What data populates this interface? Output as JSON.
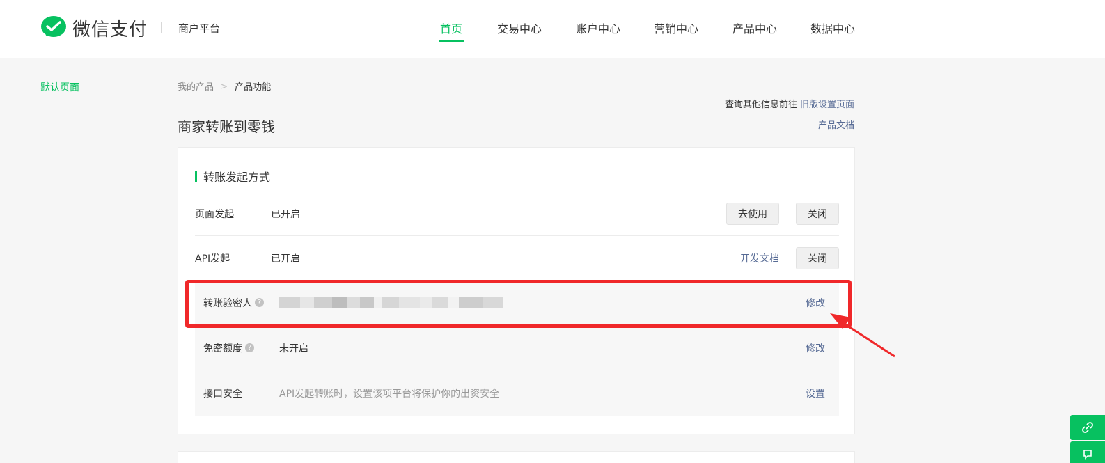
{
  "header": {
    "logo_text": "微信支付",
    "platform": "商户平台",
    "nav": [
      {
        "label": "首页",
        "active": true
      },
      {
        "label": "交易中心",
        "active": false
      },
      {
        "label": "账户中心",
        "active": false
      },
      {
        "label": "营销中心",
        "active": false
      },
      {
        "label": "产品中心",
        "active": false
      },
      {
        "label": "数据中心",
        "active": false
      }
    ]
  },
  "sidebar": {
    "items": [
      {
        "label": "默认页面",
        "active": true
      }
    ]
  },
  "breadcrumb": {
    "parent": "我的产品",
    "separator": ">",
    "current": "产品功能"
  },
  "page": {
    "title": "商家转账到零钱",
    "info_prefix": "查询其他信息前往",
    "old_settings_link": "旧版设置页面",
    "docs_link": "产品文档"
  },
  "section": {
    "title": "转账发起方式",
    "rows": [
      {
        "label": "页面发起",
        "status": "已开启",
        "primary_action": "去使用",
        "secondary_action": "关闭"
      },
      {
        "label": "API发起",
        "status": "已开启",
        "primary_action": "开发文档",
        "secondary_action": "关闭"
      }
    ],
    "sub_rows": [
      {
        "label": "转账验密人",
        "help": "?",
        "value": "",
        "action": "修改"
      },
      {
        "label": "免密额度",
        "help": "?",
        "value": "未开启",
        "action": "修改"
      },
      {
        "label": "接口安全",
        "value": "API发起转账时，设置该项平台将保护你的出资安全",
        "action": "设置"
      }
    ]
  },
  "colors": {
    "brand_green": "#07c160",
    "link_blue": "#576b95",
    "annotation_red": "#f0282a"
  },
  "icons": {
    "logo": "wechat-pay-logo-icon",
    "help": "question-circle-icon",
    "float_top": "link-icon",
    "float_bottom": "feedback-icon"
  }
}
